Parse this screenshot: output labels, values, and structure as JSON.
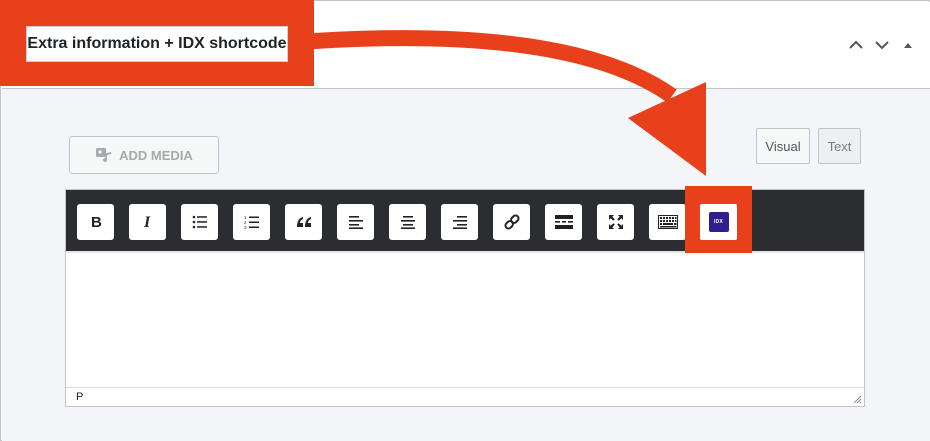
{
  "metabox": {
    "title": "Extra information + IDX shortcode",
    "actions": [
      {
        "name": "move-up",
        "icon": "chevron-up-icon"
      },
      {
        "name": "move-down",
        "icon": "chevron-down-icon"
      },
      {
        "name": "toggle-panel",
        "icon": "triangle-up-icon"
      }
    ]
  },
  "editor": {
    "add_media_label": "ADD MEDIA",
    "tabs": {
      "visual": "Visual",
      "text": "Text"
    },
    "toolbar": [
      {
        "name": "bold",
        "glyph": "B"
      },
      {
        "name": "italic",
        "glyph": "I"
      },
      {
        "name": "bulleted-list",
        "glyph": ""
      },
      {
        "name": "numbered-list",
        "glyph": ""
      },
      {
        "name": "blockquote",
        "glyph": "“"
      },
      {
        "name": "align-left",
        "glyph": ""
      },
      {
        "name": "align-center",
        "glyph": ""
      },
      {
        "name": "align-right",
        "glyph": ""
      },
      {
        "name": "insert-link",
        "glyph": ""
      },
      {
        "name": "read-more",
        "glyph": ""
      },
      {
        "name": "fullscreen",
        "glyph": ""
      },
      {
        "name": "toolbar-toggle",
        "glyph": ""
      }
    ],
    "idx_button_label": "IDX",
    "status_path": "P"
  },
  "colors": {
    "annotation": "#e8401a",
    "toolbar_bg": "#2c2d30",
    "idx_logo": "#2e1f8f"
  }
}
